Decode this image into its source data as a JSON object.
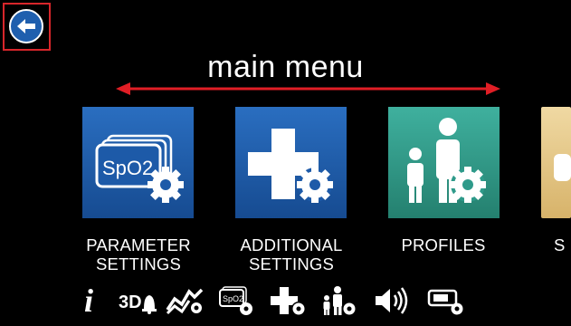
{
  "screen": {
    "title": "main menu"
  },
  "tiles": [
    {
      "line1": "PARAMETER",
      "line2": "SETTINGS",
      "badge": "SpO2",
      "color": "#1d5aa8"
    },
    {
      "line1": "ADDITIONAL",
      "line2": "SETTINGS",
      "color": "#1d5aa8"
    },
    {
      "line1": "PROFILES",
      "line2": "",
      "color": "#2e9a8a"
    },
    {
      "line1": "S",
      "line2": "",
      "color": "#e7c98a"
    }
  ],
  "toolbar": {
    "info_glyph": "i",
    "threed_label": "3D",
    "spo2_label": "SpO2"
  },
  "icons": [
    "back-arrow-icon",
    "info-icon",
    "3d-alarm-icon",
    "trend-settings-icon",
    "spo2-settings-icon",
    "additional-settings-icon",
    "profile-settings-icon",
    "volume-icon",
    "device-settings-icon"
  ]
}
